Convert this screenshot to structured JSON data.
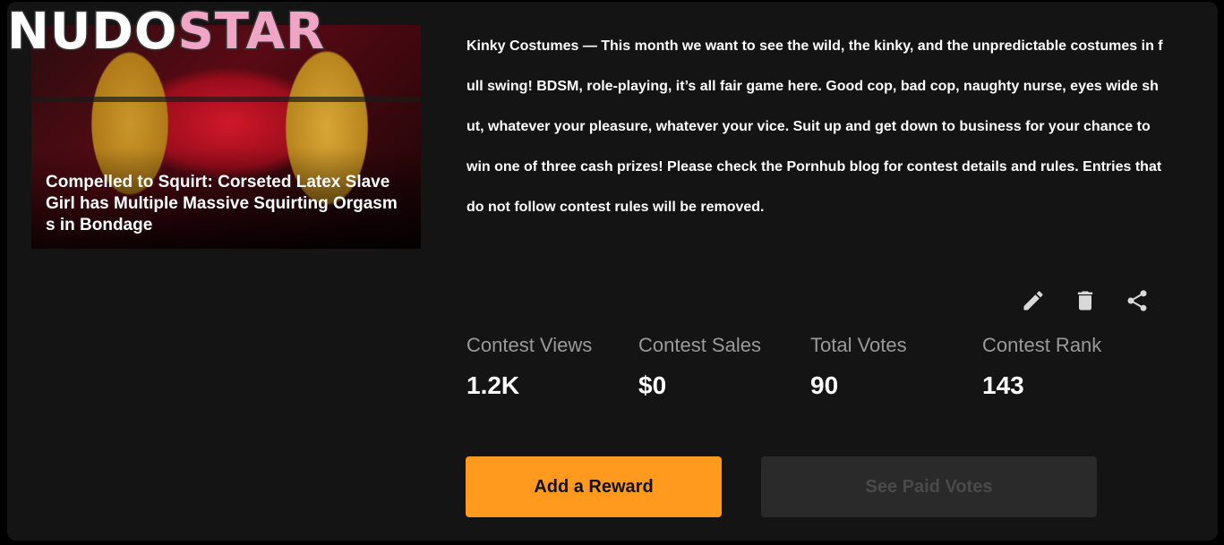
{
  "logo": {
    "part1": "NUDO",
    "part2": "STAR"
  },
  "video": {
    "title": "Compelled to Squirt: Corseted Latex Slave Girl has Multiple Massive Squirting Orgasms in Bondage"
  },
  "contest": {
    "description": "Kinky Costumes — This month we want to see the wild, the kinky, and the unpredictable costumes in full swing! BDSM, role-playing, it’s all fair game here. Good cop, bad cop, naughty nurse, eyes wide shut, whatever your pleasure, whatever your vice. Suit up and get down to business for your chance to win one of three cash prizes! Please check the Pornhub blog for contest details and rules. Entries that do not follow contest rules will be removed."
  },
  "actions": {
    "icons": [
      "pencil-icon",
      "trash-icon",
      "share-icon"
    ]
  },
  "stats": {
    "views": {
      "label": "Contest Views",
      "value": "1.2K"
    },
    "sales": {
      "label": "Contest Sales",
      "value": "$0"
    },
    "votes": {
      "label": "Total Votes",
      "value": "90"
    },
    "rank": {
      "label": "Contest Rank",
      "value": "143"
    }
  },
  "buttons": {
    "reward": "Add a Reward",
    "paid_votes": "See Paid Votes"
  },
  "colors": {
    "accent": "#ff9a1f",
    "background": "#141414",
    "disabled": "#2a2a2a"
  }
}
